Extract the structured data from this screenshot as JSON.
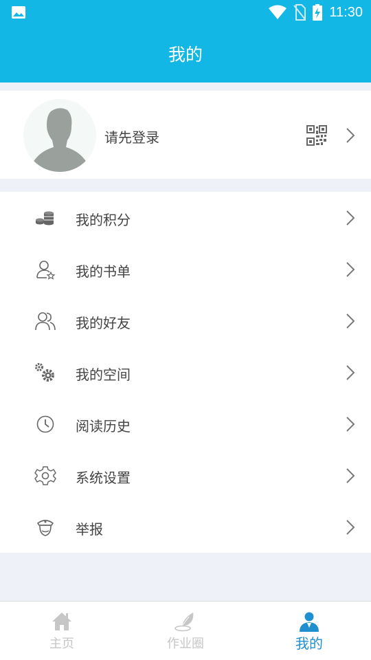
{
  "status_bar": {
    "time": "11:30"
  },
  "app_bar": {
    "title": "我的"
  },
  "profile": {
    "login_prompt": "请先登录"
  },
  "menu": {
    "items": [
      {
        "label": "我的积分",
        "icon": "coins-icon"
      },
      {
        "label": "我的书单",
        "icon": "user-star-icon"
      },
      {
        "label": "我的好友",
        "icon": "friends-icon"
      },
      {
        "label": "我的空间",
        "icon": "gears-icon"
      },
      {
        "label": "阅读历史",
        "icon": "clock-icon"
      },
      {
        "label": "系统设置",
        "icon": "settings-icon"
      },
      {
        "label": "举报",
        "icon": "police-icon"
      }
    ]
  },
  "tab_bar": {
    "tabs": [
      {
        "label": "主页",
        "icon": "home-icon",
        "active": false
      },
      {
        "label": "作业圈",
        "icon": "quill-icon",
        "active": false
      },
      {
        "label": "我的",
        "icon": "person-icon",
        "active": true
      }
    ]
  },
  "colors": {
    "primary": "#13b7e5",
    "active_tab": "#1f8fd0",
    "background": "#eef2f8"
  }
}
